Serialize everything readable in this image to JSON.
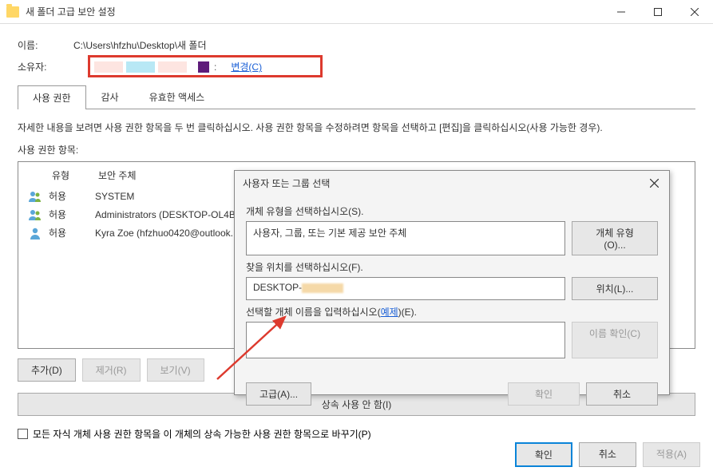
{
  "window": {
    "title": "새 폴더 고급 보안 설정"
  },
  "fields": {
    "name_label": "이름:",
    "name_value": "C:\\Users\\hfzhu\\Desktop\\새 폴더",
    "owner_label": "소유자:",
    "owner_change": "변경(C)"
  },
  "tabs": {
    "permissions": "사용 권한",
    "auditing": "감사",
    "effective": "유효한 액세스"
  },
  "description": "자세한 내용을 보려면 사용 권한 항목을 두 번 클릭하십시오. 사용 권한 항목을 수정하려면 항목을 선택하고 [편집]을 클릭하십시오(사용 가능한 경우).",
  "list": {
    "header": "사용 권한 항목:",
    "col_type": "유형",
    "col_principal": "보안 주체",
    "rows": [
      {
        "type": "허용",
        "principal": "SYSTEM",
        "icon": "group"
      },
      {
        "type": "허용",
        "principal": "Administrators (DESKTOP-OL4B7",
        "icon": "group"
      },
      {
        "type": "허용",
        "principal": "Kyra Zoe (hfzhuo0420@outlook.",
        "icon": "user"
      }
    ]
  },
  "buttons": {
    "add": "추가(D)",
    "remove": "제거(R)",
    "view": "보기(V)",
    "disable_inherit": "상속 사용 안 함(I)",
    "replace_children": "모든 자식 개체 사용 권한 항목을 이 개체의 상속 가능한 사용 권한 항목으로 바꾸기(P)",
    "ok": "확인",
    "cancel": "취소",
    "apply": "적용(A)"
  },
  "modal": {
    "title": "사용자 또는 그룹 선택",
    "obj_type_label": "개체 유형을 선택하십시오(S).",
    "obj_type_value": "사용자, 그룹, 또는 기본 제공 보안 주체",
    "obj_type_btn": "개체 유형(O)...",
    "location_label": "찾을 위치를 선택하십시오(F).",
    "location_value": "DESKTOP-",
    "location_btn": "위치(L)...",
    "name_label_pre": "선택할 개체 이름을 입력하십시오(",
    "name_label_link": "예제",
    "name_label_post": ")(E).",
    "check_names": "이름 확인(C)",
    "advanced": "고급(A)...",
    "ok": "확인",
    "cancel": "취소"
  }
}
